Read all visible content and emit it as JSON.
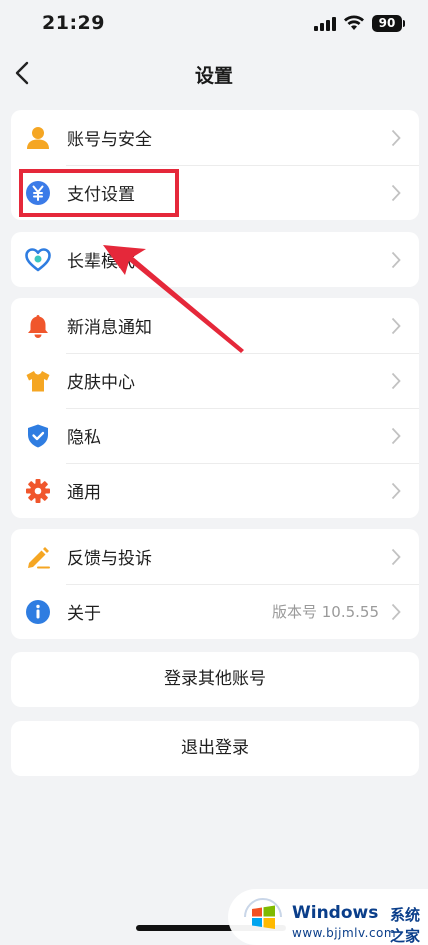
{
  "status_bar": {
    "time": "21:29",
    "battery": "90"
  },
  "nav": {
    "title": "设置"
  },
  "groups": [
    {
      "items": [
        {
          "label": "账号与安全",
          "icon": "user-icon"
        },
        {
          "label": "支付设置",
          "icon": "yuan-payment-icon"
        }
      ]
    },
    {
      "items": [
        {
          "label": "长辈模式",
          "icon": "heart-elder-icon"
        }
      ]
    },
    {
      "items": [
        {
          "label": "新消息通知",
          "icon": "bell-icon"
        },
        {
          "label": "皮肤中心",
          "icon": "tshirt-icon"
        },
        {
          "label": "隐私",
          "icon": "shield-icon"
        },
        {
          "label": "通用",
          "icon": "gear-icon"
        }
      ]
    },
    {
      "items": [
        {
          "label": "反馈与投诉",
          "icon": "pen-icon"
        },
        {
          "label": "关于",
          "icon": "info-icon",
          "value": "版本号 10.5.55"
        }
      ]
    }
  ],
  "buttons": {
    "switch_account": "登录其他账号",
    "logout": "退出登录"
  },
  "annotation": {
    "highlight_color": "#e5283a"
  },
  "watermark": {
    "brand": "Windows",
    "cn": "系统之家",
    "url": "www.bjjmlv.com"
  }
}
